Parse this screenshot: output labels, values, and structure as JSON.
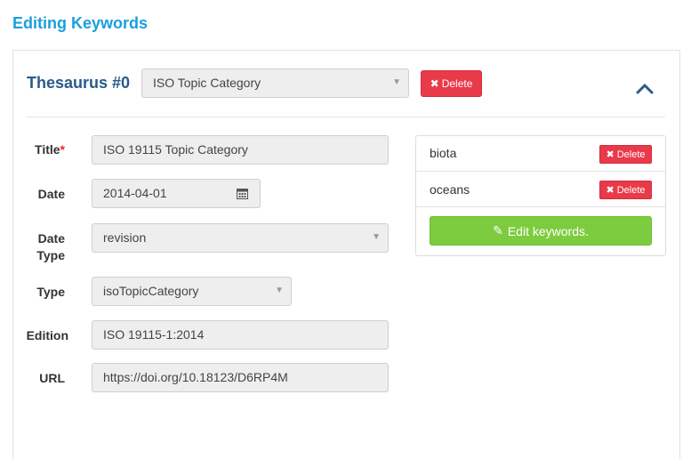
{
  "page": {
    "title": "Editing Keywords"
  },
  "thesaurus": {
    "label": "Thesaurus #0",
    "selected": "ISO Topic Category",
    "delete_label": "Delete"
  },
  "form": {
    "title_label": "Title",
    "required_mark": "*",
    "title_value": "ISO 19115 Topic Category",
    "date_label": "Date",
    "date_value": "2014-04-01",
    "date_type_label_line1": "Date",
    "date_type_label_line2": "Type",
    "date_type_value": "revision",
    "type_label": "Type",
    "type_value": "isoTopicCategory",
    "edition_label": "Edition",
    "edition_value": "ISO 19115-1:2014",
    "url_label": "URL",
    "url_value": "https://doi.org/10.18123/D6RP4M"
  },
  "keywords": {
    "items": [
      {
        "label": "biota",
        "delete_label": "Delete"
      },
      {
        "label": "oceans",
        "delete_label": "Delete"
      }
    ],
    "edit_label": "Edit keywords."
  },
  "colors": {
    "accent": "#1a9fdc",
    "heading": "#2a5a8a",
    "danger": "#e93a4a",
    "success": "#7dcc3f"
  },
  "icons": [
    "chevron-up-icon",
    "calendar-icon",
    "times-icon",
    "pencil-icon",
    "caret-down-icon"
  ]
}
